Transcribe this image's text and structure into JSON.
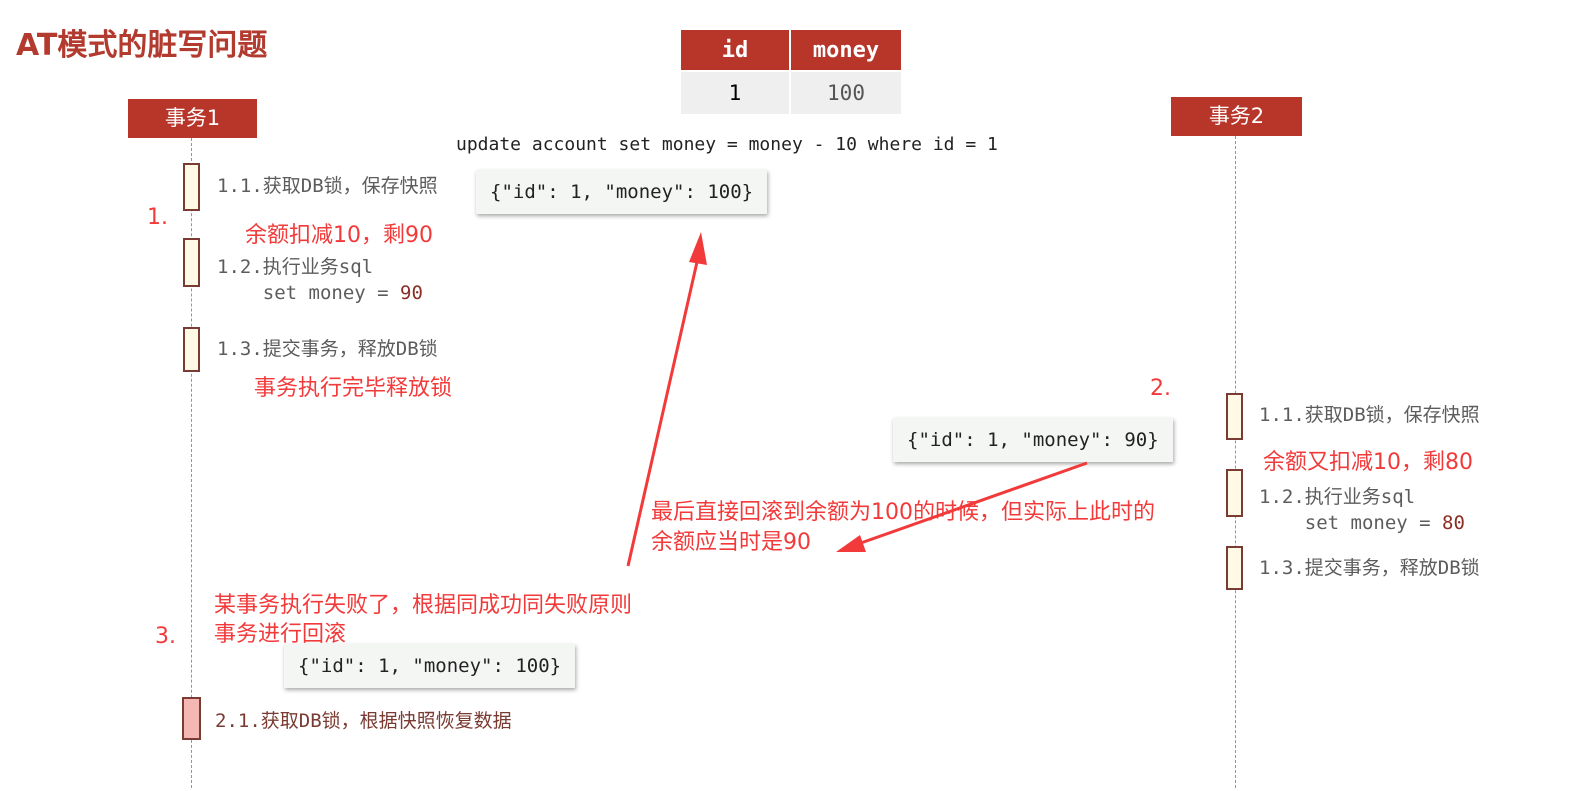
{
  "title": "AT模式的脏写问题",
  "table": {
    "headers": [
      "id",
      "money"
    ],
    "rows": [
      [
        "1",
        "100"
      ]
    ]
  },
  "sql": "update account set money = money - 10 where id = 1",
  "actors": [
    {
      "label": "事务1"
    },
    {
      "label": "事务2"
    }
  ],
  "tx1": {
    "steps": [
      {
        "text": "1.1.获取DB锁，保存快照"
      },
      {
        "text": "1.2.执行业务sql",
        "line2": "    set money = ",
        "value": "90"
      },
      {
        "text": "1.3.提交事务，释放DB锁"
      }
    ],
    "snapshot": "{\"id\": 1, \"money\": 100}",
    "rollback_step": "2.1.获取DB锁，根据快照恢复数据",
    "rollback_snapshot": "{\"id\": 1, \"money\": 100}"
  },
  "tx2": {
    "steps": [
      {
        "text": "1.1.获取DB锁，保存快照"
      },
      {
        "text": "1.2.执行业务sql",
        "line2": "    set money = ",
        "value": "80"
      },
      {
        "text": "1.3.提交事务，释放DB锁"
      }
    ],
    "snapshot": "{\"id\": 1, \"money\": 90}"
  },
  "annotations": {
    "marker1": "1.",
    "marker2": "2.",
    "marker3": "3.",
    "deduct10": "余额扣减10，剩90",
    "release_lock": "事务执行完毕释放锁",
    "deduct_again": "余额又扣减10，剩80",
    "rollback_note_line1": "最后直接回滚到余额为100的时候，但实际上此时的",
    "rollback_note_line2": "余额应当时是90",
    "failure_line1": "某事务执行失败了，根据同成功同失败原则",
    "failure_line2": "事务进行回滚"
  },
  "colors": {
    "actor_bg": "#b8352a",
    "annotation_red": "#f23a3a",
    "activation_fill": "#fff9e6",
    "rollback_fill": "#f4b7b3"
  }
}
